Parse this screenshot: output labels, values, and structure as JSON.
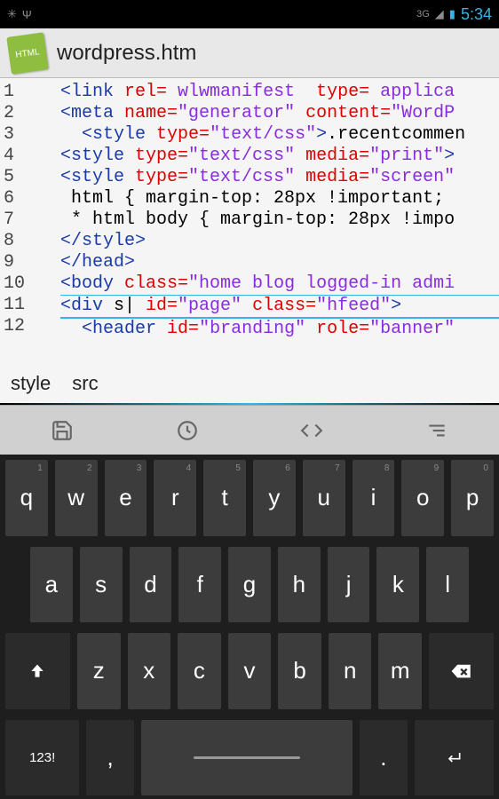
{
  "statusbar": {
    "time": "5:34",
    "net": "3G"
  },
  "titlebar": {
    "filename": "wordpress.htm",
    "icon_label": "HTML"
  },
  "editor": {
    "line_numbers": [
      "1",
      "2",
      "3",
      "4",
      "5",
      "6",
      "7",
      "8",
      "9",
      "10",
      "11",
      "12",
      ""
    ],
    "lines": [
      {
        "segs": [
          {
            "c": "tag",
            "t": "<link"
          },
          {
            "c": "",
            "t": " "
          },
          {
            "c": "attr",
            "t": "rel="
          },
          {
            "c": "val",
            "t": " wlwmanifest "
          },
          {
            "c": "",
            "t": " "
          },
          {
            "c": "attr",
            "t": "type="
          },
          {
            "c": "val",
            "t": " applica"
          }
        ]
      },
      {
        "segs": [
          {
            "c": "tag",
            "t": "<meta"
          },
          {
            "c": "",
            "t": " "
          },
          {
            "c": "attr",
            "t": "name="
          },
          {
            "c": "val",
            "t": "\"generator\""
          },
          {
            "c": "",
            "t": " "
          },
          {
            "c": "attr",
            "t": "content="
          },
          {
            "c": "val",
            "t": "\"WordP"
          }
        ]
      },
      {
        "segs": [
          {
            "c": "",
            "t": "  "
          },
          {
            "c": "tag",
            "t": "<style"
          },
          {
            "c": "",
            "t": " "
          },
          {
            "c": "attr",
            "t": "type="
          },
          {
            "c": "val",
            "t": "\"text/css\""
          },
          {
            "c": "tag",
            "t": ">"
          },
          {
            "c": "",
            "t": ".recentcommen"
          }
        ]
      },
      {
        "segs": [
          {
            "c": "tag",
            "t": "<style"
          },
          {
            "c": "",
            "t": " "
          },
          {
            "c": "attr",
            "t": "type="
          },
          {
            "c": "val",
            "t": "\"text/css\""
          },
          {
            "c": "",
            "t": " "
          },
          {
            "c": "attr",
            "t": "media="
          },
          {
            "c": "val",
            "t": "\"print\""
          },
          {
            "c": "tag",
            "t": ">"
          }
        ]
      },
      {
        "segs": [
          {
            "c": "tag",
            "t": "<style"
          },
          {
            "c": "",
            "t": " "
          },
          {
            "c": "attr",
            "t": "type="
          },
          {
            "c": "val",
            "t": "\"text/css\""
          },
          {
            "c": "",
            "t": " "
          },
          {
            "c": "attr",
            "t": "media="
          },
          {
            "c": "val",
            "t": "\"screen\""
          }
        ]
      },
      {
        "segs": [
          {
            "c": "",
            "t": " html { margin-top: 28px !important;"
          }
        ]
      },
      {
        "segs": [
          {
            "c": "",
            "t": " * html body { margin-top: 28px !impo"
          }
        ]
      },
      {
        "segs": [
          {
            "c": "tag",
            "t": "</style>"
          }
        ]
      },
      {
        "segs": [
          {
            "c": "tag",
            "t": "</head>"
          }
        ]
      },
      {
        "segs": [
          {
            "c": "",
            "t": ""
          }
        ]
      },
      {
        "segs": [
          {
            "c": "tag",
            "t": "<body"
          },
          {
            "c": "",
            "t": " "
          },
          {
            "c": "attr",
            "t": "class="
          },
          {
            "c": "val",
            "t": "\"home blog logged-in admi"
          }
        ]
      },
      {
        "segs": [
          {
            "c": "tag",
            "t": "<div"
          },
          {
            "c": "",
            "t": " s| "
          },
          {
            "c": "attr",
            "t": "id="
          },
          {
            "c": "val",
            "t": "\"page\""
          },
          {
            "c": "",
            "t": " "
          },
          {
            "c": "attr",
            "t": "class="
          },
          {
            "c": "val",
            "t": "\"hfeed\""
          },
          {
            "c": "tag",
            "t": ">"
          }
        ],
        "cursor": true
      },
      {
        "segs": [
          {
            "c": "",
            "t": "  "
          },
          {
            "c": "tag",
            "t": "<header"
          },
          {
            "c": "",
            "t": " "
          },
          {
            "c": "attr",
            "t": "id="
          },
          {
            "c": "val",
            "t": "\"branding\""
          },
          {
            "c": "",
            "t": " "
          },
          {
            "c": "attr",
            "t": "role="
          },
          {
            "c": "val",
            "t": "\"banner\""
          }
        ]
      }
    ]
  },
  "suggestions": [
    "style",
    "src"
  ],
  "toolbar": [
    "save",
    "history",
    "code",
    "menu"
  ],
  "keyboard": {
    "row1": [
      {
        "k": "q",
        "n": "1"
      },
      {
        "k": "w",
        "n": "2"
      },
      {
        "k": "e",
        "n": "3"
      },
      {
        "k": "r",
        "n": "4"
      },
      {
        "k": "t",
        "n": "5"
      },
      {
        "k": "y",
        "n": "6"
      },
      {
        "k": "u",
        "n": "7"
      },
      {
        "k": "i",
        "n": "8"
      },
      {
        "k": "o",
        "n": "9"
      },
      {
        "k": "p",
        "n": "0"
      }
    ],
    "row2": [
      {
        "k": "a"
      },
      {
        "k": "s"
      },
      {
        "k": "d"
      },
      {
        "k": "f"
      },
      {
        "k": "g"
      },
      {
        "k": "h"
      },
      {
        "k": "j"
      },
      {
        "k": "k"
      },
      {
        "k": "l"
      }
    ],
    "row3": [
      {
        "k": "z"
      },
      {
        "k": "x"
      },
      {
        "k": "c"
      },
      {
        "k": "v"
      },
      {
        "k": "b"
      },
      {
        "k": "n"
      },
      {
        "k": "m"
      }
    ],
    "row4": {
      "sym": "123!",
      "comma": ",",
      "period": "."
    }
  }
}
